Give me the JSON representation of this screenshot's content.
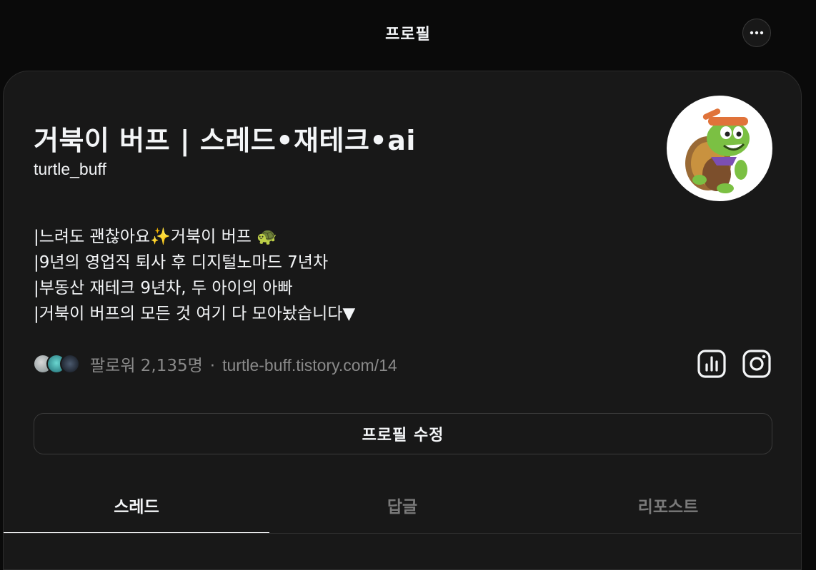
{
  "header": {
    "title": "프로필"
  },
  "profile": {
    "name": "거북이 버프 | 스레드•재테크•ai",
    "handle": "turtle_buff",
    "bio_lines": [
      "|느려도 괜찮아요✨거북이 버프 🐢",
      "|9년의 영업직 퇴사 후 디지털노마드 7년차",
      "|부동산 재테크 9년차, 두 아이의 아빠",
      "|거북이 버프의 모든 것 여기 다 모아놨습니다▼"
    ],
    "followers_text": "팔로워 2,135명",
    "separator": "·",
    "link": "turtle-buff.tistory.com/14",
    "edit_button_label": "프로필 수정"
  },
  "tabs": [
    {
      "label": "스레드",
      "active": true
    },
    {
      "label": "답글",
      "active": false
    },
    {
      "label": "리포스트",
      "active": false
    }
  ],
  "icons": {
    "more": "more-options-icon",
    "insights": "insights-icon",
    "instagram": "instagram-icon"
  },
  "colors": {
    "background": "#0a0a0a",
    "card": "#181818",
    "text_primary": "#f3f5f7",
    "text_secondary": "#8a8a8a"
  }
}
